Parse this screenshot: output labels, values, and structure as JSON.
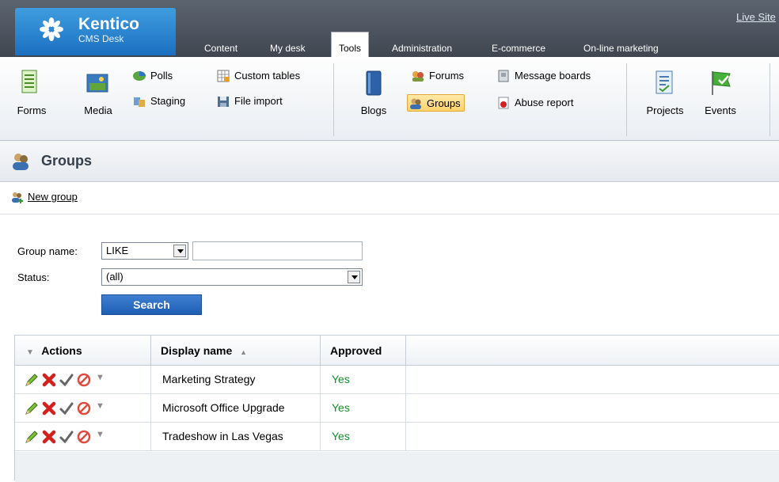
{
  "app": {
    "name": "Kentico",
    "subtitle": "CMS Desk",
    "live_site": "Live Site"
  },
  "tabs": [
    {
      "label": "Content",
      "active": false
    },
    {
      "label": "My desk",
      "active": false
    },
    {
      "label": "Tools",
      "active": true
    },
    {
      "label": "Administration",
      "active": false
    },
    {
      "label": "E-commerce",
      "active": false
    },
    {
      "label": "On-line marketing",
      "active": false
    }
  ],
  "ribbon": {
    "groups": "Groups",
    "forms": "Forms",
    "media": "Media",
    "polls": "Polls",
    "staging": "Staging",
    "custom_tables": "Custom tables",
    "file_import": "File import",
    "blogs": "Blogs",
    "forums": "Forums",
    "message_boards": "Message boards",
    "abuse_report": "Abuse report",
    "projects": "Projects",
    "events": "Events"
  },
  "page": {
    "title": "Groups",
    "new_group": "New group"
  },
  "filter": {
    "group_name_label": "Group name:",
    "operator": "LIKE",
    "group_name_value": "",
    "status_label": "Status:",
    "status_value": "(all)",
    "search": "Search"
  },
  "grid": {
    "headers": {
      "actions": "Actions",
      "display_name": "Display name",
      "approved": "Approved"
    },
    "rows": [
      {
        "display_name": "Marketing Strategy",
        "approved": "Yes"
      },
      {
        "display_name": "Microsoft Office Upgrade",
        "approved": "Yes"
      },
      {
        "display_name": "Tradeshow in Las Vegas",
        "approved": "Yes"
      }
    ]
  },
  "colors": {
    "header_bg": "#4a525c",
    "accent_blue": "#1e5fb4",
    "approved_green": "#1b8a2d",
    "selected_orange": "#ffd36a"
  }
}
